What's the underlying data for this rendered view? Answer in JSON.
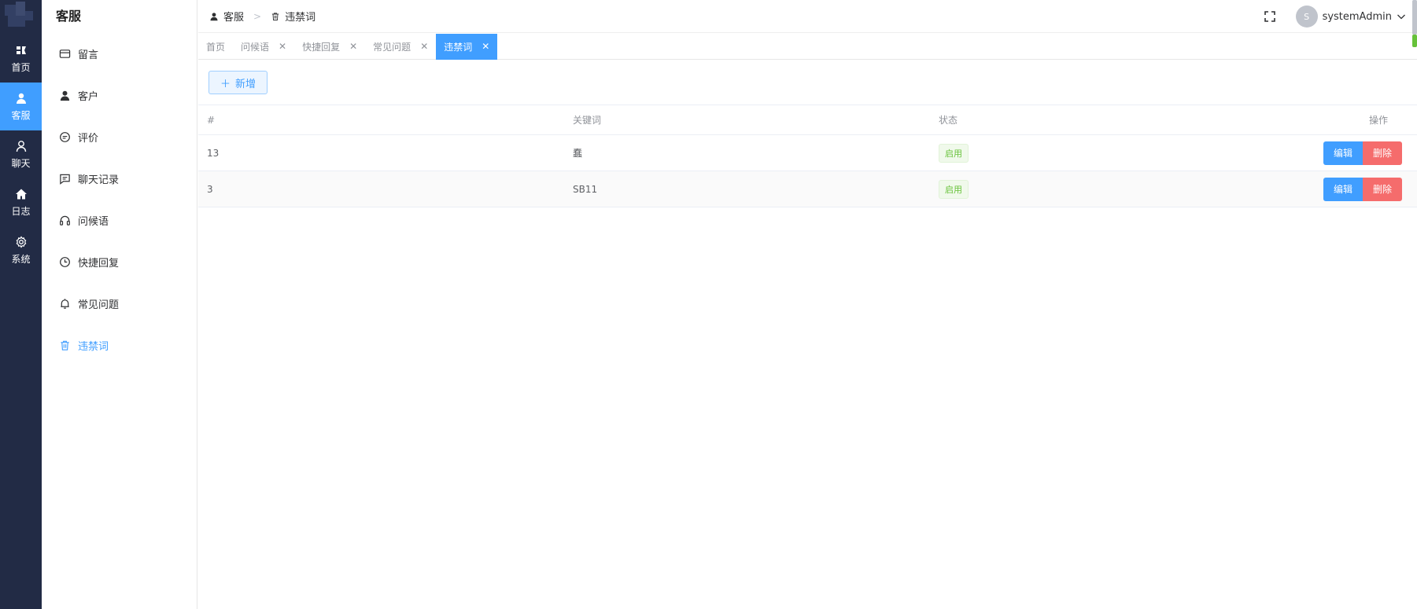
{
  "rail": {
    "items": [
      {
        "label": "首页",
        "icon": "dashboard-icon"
      },
      {
        "label": "客服",
        "icon": "user-icon"
      },
      {
        "label": "聊天",
        "icon": "user-outline-icon"
      },
      {
        "label": "日志",
        "icon": "home-icon"
      },
      {
        "label": "系统",
        "icon": "gear-icon"
      }
    ]
  },
  "subnav": {
    "title": "客服",
    "items": [
      {
        "label": "留言",
        "icon": "card-icon"
      },
      {
        "label": "客户",
        "icon": "person-icon"
      },
      {
        "label": "评价",
        "icon": "chat-bubble-icon"
      },
      {
        "label": "聊天记录",
        "icon": "message-icon"
      },
      {
        "label": "问候语",
        "icon": "headset-icon"
      },
      {
        "label": "快捷回复",
        "icon": "clock-icon"
      },
      {
        "label": "常见问题",
        "icon": "bell-icon"
      },
      {
        "label": "违禁词",
        "icon": "trash-icon"
      }
    ]
  },
  "header": {
    "breadcrumb": [
      "客服",
      "违禁词"
    ],
    "avatar_initial": "S",
    "username": "systemAdmin"
  },
  "tabs": [
    {
      "label": "首页",
      "closable": false
    },
    {
      "label": "问候语",
      "closable": true
    },
    {
      "label": "快捷回复",
      "closable": true
    },
    {
      "label": "常见问题",
      "closable": true
    },
    {
      "label": "违禁词",
      "closable": true
    }
  ],
  "toolbar": {
    "add_label": "新增"
  },
  "table": {
    "headers": [
      "#",
      "关键词",
      "状态",
      "操作"
    ],
    "rows": [
      {
        "id": "13",
        "keyword": "蠢",
        "status": "启用"
      },
      {
        "id": "3",
        "keyword": "SB11",
        "status": "启用"
      }
    ],
    "edit_label": "编辑",
    "delete_label": "删除"
  },
  "colors": {
    "accent": "#409eff",
    "rail_bg": "#222b45",
    "danger": "#f56c6c",
    "success": "#67c23a"
  }
}
